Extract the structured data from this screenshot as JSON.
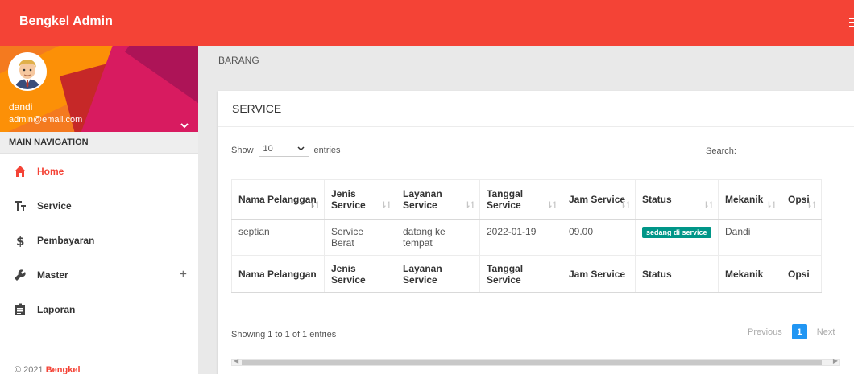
{
  "header": {
    "brand": "Bengkel Admin"
  },
  "user": {
    "name": "dandi",
    "email": "admin@email.com"
  },
  "sidebar": {
    "nav_header": "MAIN NAVIGATION",
    "items": [
      {
        "label": "Home",
        "icon": "home-icon",
        "active": true
      },
      {
        "label": "Service",
        "icon": "text-fields-icon"
      },
      {
        "label": "Pembayaran",
        "icon": "dollar-icon"
      },
      {
        "label": "Master",
        "icon": "wrench-icon",
        "expand": "+"
      },
      {
        "label": "Laporan",
        "icon": "assignment-icon"
      }
    ],
    "footer_prefix": "© 2021 ",
    "footer_brand": "Bengkel"
  },
  "breadcrumb": "BARANG",
  "card": {
    "title": "SERVICE",
    "length_prefix": "Show",
    "length_value": "10",
    "length_suffix": "entries",
    "search_label": "Search:",
    "search_value": ""
  },
  "table": {
    "headers": [
      "Nama Pelanggan",
      "Jenis Service",
      "Layanan Service",
      "Tanggal Service",
      "Jam Service",
      "Status",
      "Mekanik",
      "Opsi"
    ],
    "rows": [
      {
        "nama": "septian",
        "jenis": "Service Berat",
        "layanan": "datang ke tempat",
        "tanggal": "2022-01-19",
        "jam": "09.00",
        "status": "sedang di service",
        "mekanik": "Dandi",
        "opsi": ""
      }
    ],
    "footers": [
      "Nama Pelanggan",
      "Jenis Service",
      "Layanan Service",
      "Tanggal Service",
      "Jam Service",
      "Status",
      "Mekanik",
      "Opsi"
    ]
  },
  "info": "Showing 1 to 1 of 1 entries",
  "pagination": {
    "previous": "Previous",
    "current": "1",
    "next": "Next"
  },
  "colors": {
    "primary": "#f44336",
    "badge": "#009688",
    "page_active": "#2196f3"
  }
}
